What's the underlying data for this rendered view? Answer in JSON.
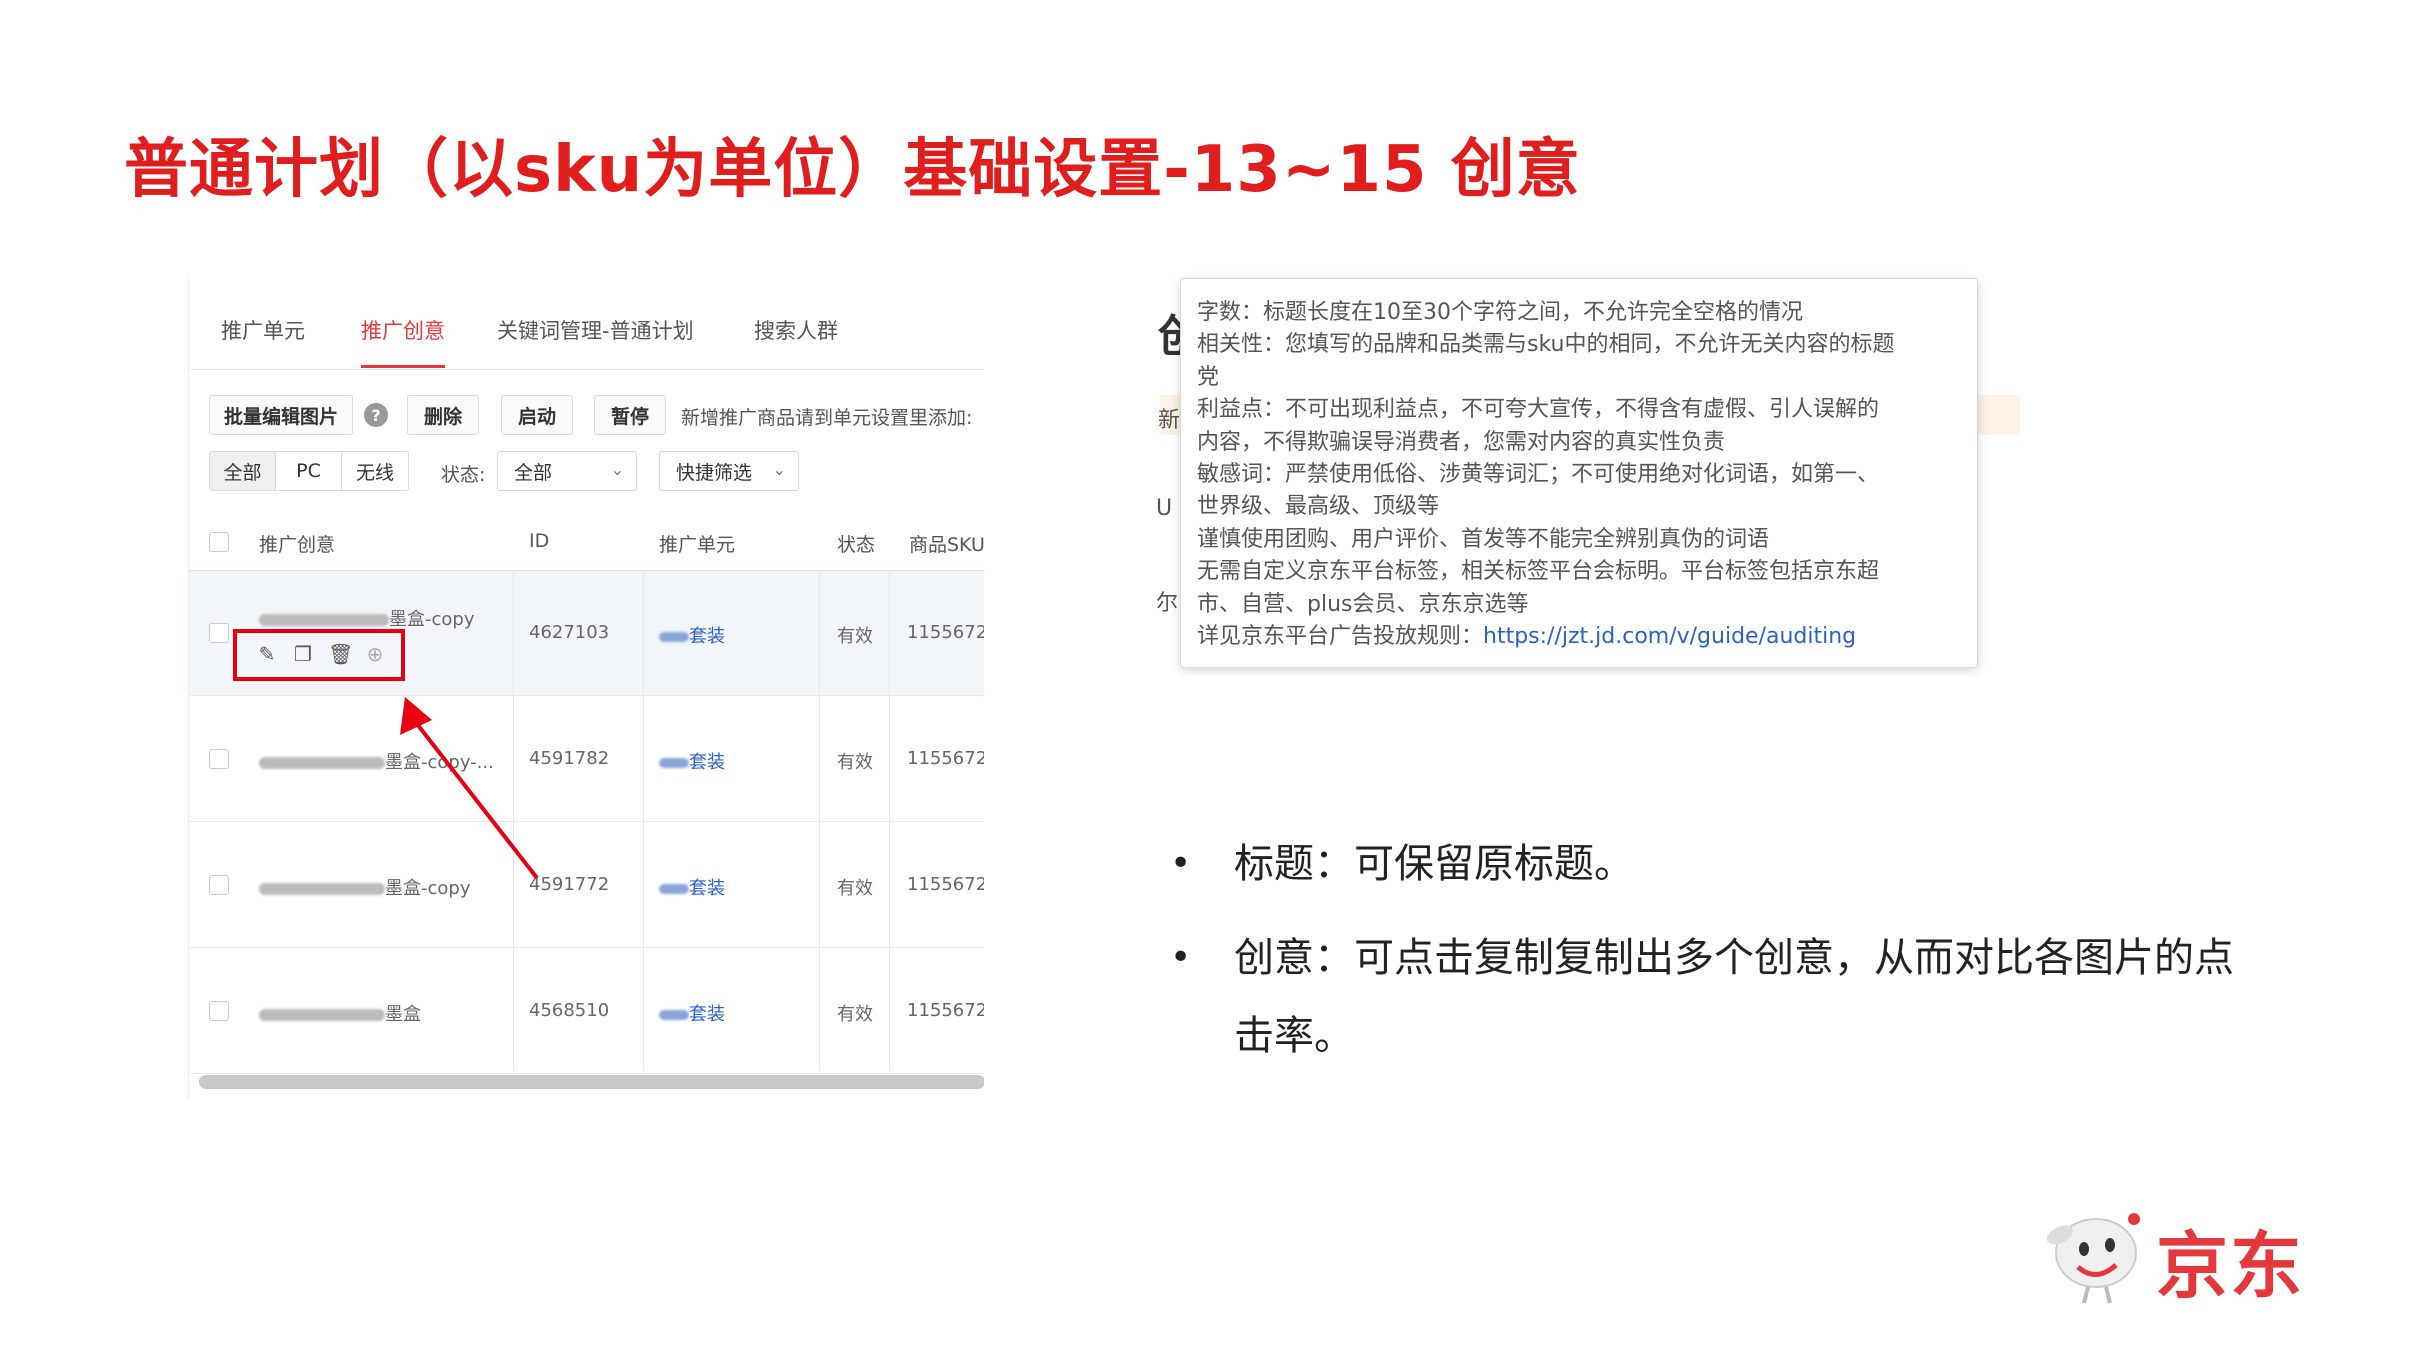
{
  "slide": {
    "title": "普通计划（以sku为单位）基础设置-13~15 创意"
  },
  "ui_panel": {
    "tabs": [
      {
        "label": "推广单元",
        "active": false
      },
      {
        "label": "推广创意",
        "active": true
      },
      {
        "label": "关键词管理-普通计划",
        "active": false
      },
      {
        "label": "搜索人群",
        "active": false
      }
    ],
    "toolbar": {
      "batch_edit_label": "批量编辑图片",
      "help_icon": "question-circle-icon",
      "delete_label": "删除",
      "start_label": "启动",
      "pause_label": "暂停",
      "tip": "新增推广商品请到单元设置里添加:"
    },
    "filters": {
      "segments": [
        "全部",
        "PC",
        "无线"
      ],
      "status_label": "状态:",
      "status_value": "全部",
      "quick_filter": "快捷筛选"
    },
    "table": {
      "headers": [
        "推广创意",
        "ID",
        "推广单元",
        "状态",
        "商品SKU"
      ],
      "rows": [
        {
          "creative": "墨盒-copy",
          "id": "4627103",
          "unit": "套装",
          "status": "有效",
          "sku": "1155672"
        },
        {
          "creative": "墨盒-copy-...",
          "id": "4591782",
          "unit": "套装",
          "status": "有效",
          "sku": "1155672"
        },
        {
          "creative": "墨盒-copy",
          "id": "4591772",
          "unit": "套装",
          "status": "有效",
          "sku": "1155672"
        },
        {
          "creative": "墨盒",
          "id": "4568510",
          "unit": "套装",
          "status": "有效",
          "sku": "1155672"
        }
      ],
      "row_actions": [
        "edit-icon",
        "copy-icon",
        "delete-icon",
        "upload-icon"
      ]
    },
    "highlight_color": "#e60012"
  },
  "tooltip": {
    "lines": [
      "字数：标题长度在10至30个字符之间，不允许完全空格的情况",
      "相关性：您填写的品牌和品类需与sku中的相同，不允许无关内容的标题",
      "党",
      "利益点：不可出现利益点，不可夸大宣传，不得含有虚假、引人误解的",
      "内容，不得欺骗误导消费者，您需对内容的真实性负责",
      "敏感词：严禁使用低俗、涉黄等词汇；不可使用绝对化词语，如第一、",
      "世界级、最高级、顶级等",
      "谨慎使用团购、用户评价、首发等不能完全辨别真伪的词语",
      "无需自定义京东平台标签，相关标签平台会标明。平台标签包括京东超",
      "市、自营、plus会员、京东京选等"
    ],
    "rule_prefix": "详见京东平台广告投放规则：",
    "rule_link": "https://jzt.jd.com/v/guide/auditing",
    "bg_letters": [
      "创",
      "新",
      "U",
      "尔"
    ]
  },
  "bullets": [
    "标题：可保留原标题。",
    "创意：可点击复制复制出多个创意，从而对比各图片的点击率。"
  ],
  "logo": {
    "text": "京东",
    "icon": "jd-dog-mascot-icon",
    "color": "#e4393c"
  },
  "colors": {
    "title_red": "#e01e1e",
    "arrow_red": "#e60012",
    "link_blue": "#2b62c6"
  }
}
